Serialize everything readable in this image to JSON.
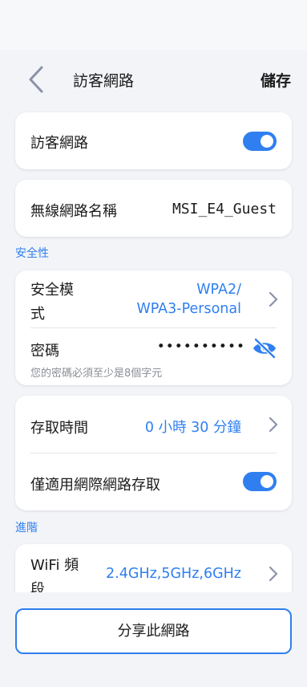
{
  "header": {
    "title": "訪客網路",
    "save_label": "儲存"
  },
  "guest_network": {
    "label": "訪客網路",
    "enabled": true
  },
  "ssid": {
    "label": "無線網路名稱",
    "value": "MSI_E4_Guest"
  },
  "security_section": {
    "label": "安全性"
  },
  "security_mode": {
    "label_line1": "安全模",
    "label_line2": "式",
    "value_line1": "WPA2/",
    "value_line2": "WPA3-Personal"
  },
  "password": {
    "label": "密碼",
    "masked_value": "••••••••••",
    "hint": "您的密碼必須至少是8個字元"
  },
  "access_time": {
    "label": "存取時間",
    "value": "0 小時 30 分鐘"
  },
  "internet_only": {
    "label": "僅適用網際網路存取",
    "enabled": true
  },
  "advanced_section": {
    "label": "進階"
  },
  "wifi_band": {
    "label_line1": "WiFi 頻",
    "label_line2": "段",
    "value": "2.4GHz,5GHz,6GHz"
  },
  "share_button": {
    "label": "分享此網路"
  },
  "colors": {
    "accent": "#2f7ff0",
    "background": "#f2f4f8",
    "card": "#ffffff"
  },
  "icons": {
    "back": "chevron-left-icon",
    "eye": "eye-off-icon",
    "chevron": "chevron-right-icon"
  }
}
